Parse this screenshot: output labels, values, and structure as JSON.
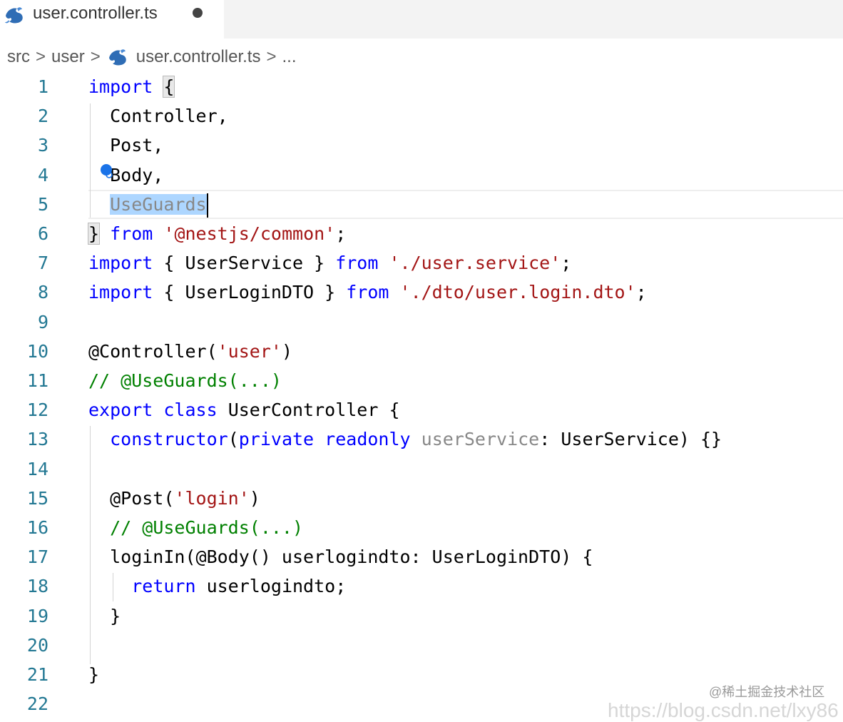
{
  "tab": {
    "filename": "user.controller.ts",
    "icon": "nestjs-icon",
    "modified": true
  },
  "breadcrumb": {
    "items": [
      "src",
      "user",
      "user.controller.ts",
      "..."
    ],
    "separator": ">"
  },
  "lines": [
    {
      "n": "1",
      "t": [
        [
          "kw",
          "import"
        ],
        [
          "plain",
          " "
        ],
        [
          "braceHL",
          "{"
        ]
      ]
    },
    {
      "n": "2",
      "t": [
        [
          "plain",
          "  Controller,"
        ]
      ]
    },
    {
      "n": "3",
      "t": [
        [
          "plain",
          "  Post,"
        ]
      ]
    },
    {
      "n": "4",
      "t": [
        [
          "plain",
          "  Body,"
        ]
      ]
    },
    {
      "n": "5",
      "t": [
        [
          "plain",
          "  "
        ],
        [
          "sel",
          "UseGuards"
        ],
        [
          "caret",
          ""
        ]
      ]
    },
    {
      "n": "6",
      "t": [
        [
          "braceHL",
          "}"
        ],
        [
          "plain",
          " "
        ],
        [
          "kw",
          "from"
        ],
        [
          "plain",
          " "
        ],
        [
          "str",
          "'@nestjs/common'"
        ],
        [
          "plain",
          ";"
        ]
      ]
    },
    {
      "n": "7",
      "t": [
        [
          "kw",
          "import"
        ],
        [
          "plain",
          " { UserService } "
        ],
        [
          "kw",
          "from"
        ],
        [
          "plain",
          " "
        ],
        [
          "str",
          "'./user.service'"
        ],
        [
          "plain",
          ";"
        ]
      ]
    },
    {
      "n": "8",
      "t": [
        [
          "kw",
          "import"
        ],
        [
          "plain",
          " { UserLoginDTO } "
        ],
        [
          "kw",
          "from"
        ],
        [
          "plain",
          " "
        ],
        [
          "str",
          "'./dto/user.login.dto'"
        ],
        [
          "plain",
          ";"
        ]
      ]
    },
    {
      "n": "9",
      "t": []
    },
    {
      "n": "10",
      "t": [
        [
          "plain",
          "@Controller("
        ],
        [
          "str",
          "'user'"
        ],
        [
          "plain",
          ")"
        ]
      ]
    },
    {
      "n": "11",
      "t": [
        [
          "cmt",
          "// @UseGuards(...)"
        ]
      ]
    },
    {
      "n": "12",
      "t": [
        [
          "kw",
          "export"
        ],
        [
          "plain",
          " "
        ],
        [
          "kw",
          "class"
        ],
        [
          "plain",
          " UserController {"
        ]
      ]
    },
    {
      "n": "13",
      "t": [
        [
          "plain",
          "  "
        ],
        [
          "kw",
          "constructor"
        ],
        [
          "plain",
          "("
        ],
        [
          "kw",
          "private"
        ],
        [
          "plain",
          " "
        ],
        [
          "kw",
          "readonly"
        ],
        [
          "plain",
          " "
        ],
        [
          "dim",
          "userService"
        ],
        [
          "plain",
          ": UserService) {}"
        ]
      ]
    },
    {
      "n": "14",
      "t": []
    },
    {
      "n": "15",
      "t": [
        [
          "plain",
          "  @Post("
        ],
        [
          "str",
          "'login'"
        ],
        [
          "plain",
          ")"
        ]
      ]
    },
    {
      "n": "16",
      "t": [
        [
          "plain",
          "  "
        ],
        [
          "cmt",
          "// @UseGuards(...)"
        ]
      ]
    },
    {
      "n": "17",
      "t": [
        [
          "plain",
          "  loginIn(@Body() userlogindto: UserLoginDTO) {"
        ]
      ]
    },
    {
      "n": "18",
      "t": [
        [
          "plain",
          "    "
        ],
        [
          "kw",
          "return"
        ],
        [
          "plain",
          " userlogindto;"
        ]
      ]
    },
    {
      "n": "19",
      "t": [
        [
          "plain",
          "  }"
        ]
      ]
    },
    {
      "n": "20",
      "t": []
    },
    {
      "n": "21",
      "t": [
        [
          "plain",
          "}"
        ]
      ]
    },
    {
      "n": "22",
      "t": []
    }
  ],
  "current_line": "5",
  "watermark": {
    "primary": "@稀土掘金技术社区",
    "secondary": "https://blog.csdn.net/lxy86"
  }
}
